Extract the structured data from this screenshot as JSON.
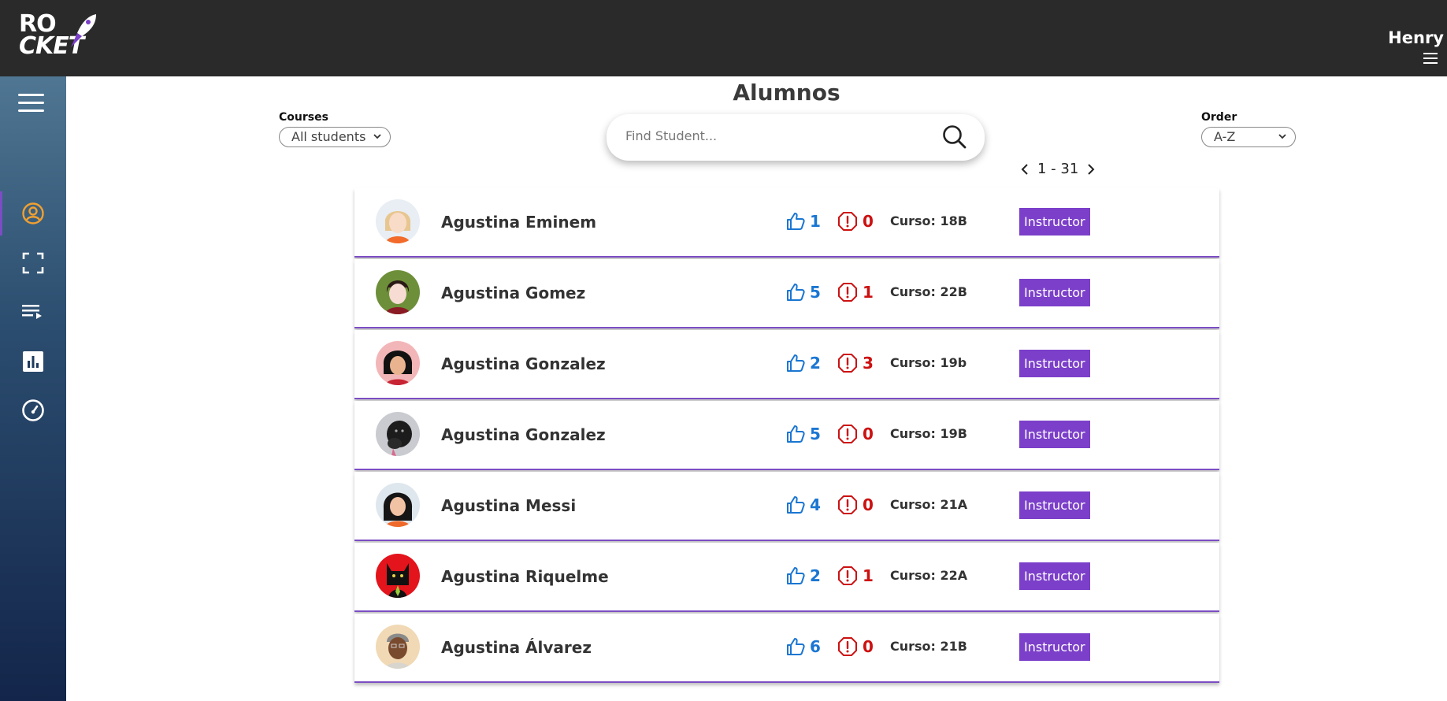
{
  "app": {
    "logo_line1": "RO",
    "logo_line2": "CKET",
    "user_name": "Henry"
  },
  "sidebar": {
    "items": [
      {
        "icon": "user-circle-icon",
        "active": true
      },
      {
        "icon": "fullscreen-icon",
        "active": false
      },
      {
        "icon": "playlist-icon",
        "active": false
      },
      {
        "icon": "bar-chart-icon",
        "active": false
      },
      {
        "icon": "dashboard-gauge-icon",
        "active": false
      }
    ]
  },
  "page": {
    "title": "Alumnos",
    "courses_label": "Courses",
    "courses_selected": "All students",
    "order_label": "Order",
    "order_selected": "A-Z",
    "search_placeholder": "Find Student...",
    "pagination": "1 - 31"
  },
  "students": [
    {
      "name": "Agustina Eminem",
      "likes": "1",
      "alerts": "0",
      "curso": "Curso: 18B",
      "role": "Instructor"
    },
    {
      "name": "Agustina Gomez",
      "likes": "5",
      "alerts": "1",
      "curso": "Curso: 22B",
      "role": "Instructor"
    },
    {
      "name": "Agustina Gonzalez",
      "likes": "2",
      "alerts": "3",
      "curso": "Curso: 19b",
      "role": "Instructor"
    },
    {
      "name": "Agustina Gonzalez",
      "likes": "5",
      "alerts": "0",
      "curso": "Curso: 19B",
      "role": "Instructor"
    },
    {
      "name": "Agustina Messi",
      "likes": "4",
      "alerts": "0",
      "curso": "Curso: 21A",
      "role": "Instructor"
    },
    {
      "name": "Agustina Riquelme",
      "likes": "2",
      "alerts": "1",
      "curso": "Curso: 22A",
      "role": "Instructor"
    },
    {
      "name": "Agustina Álvarez",
      "likes": "6",
      "alerts": "0",
      "curso": "Curso: 21B",
      "role": "Instructor"
    }
  ],
  "colors": {
    "accent": "#7b3fc9",
    "like": "#1a76d2",
    "alert": "#cc1111",
    "topbar": "#2a2a2a",
    "sidebar_active_icon": "#f0a030"
  }
}
